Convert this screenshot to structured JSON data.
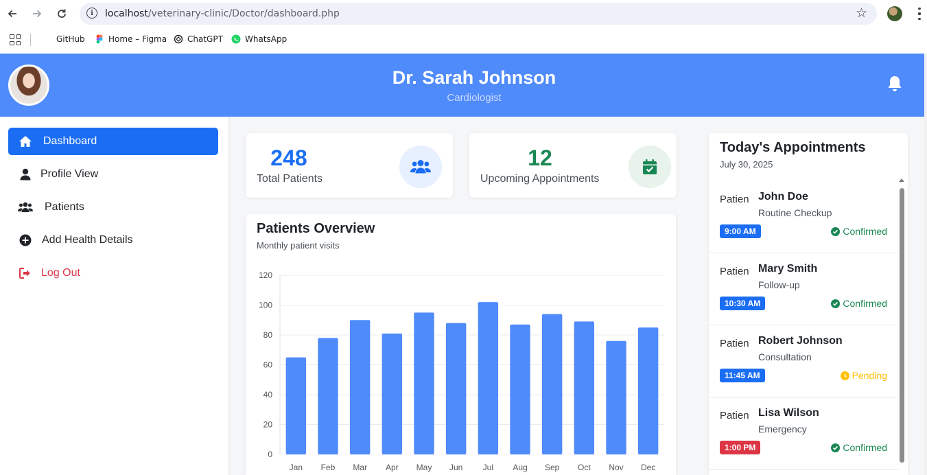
{
  "browser": {
    "url_host": "localhost",
    "url_path": "/veterinary-clinic/Doctor/dashboard.php",
    "bookmarks": [
      {
        "label": "GitHub",
        "icon": "github-icon"
      },
      {
        "label": "Home – Figma",
        "icon": "figma-icon"
      },
      {
        "label": "ChatGPT",
        "icon": "chatgpt-icon"
      },
      {
        "label": "WhatsApp",
        "icon": "whatsapp-icon"
      }
    ]
  },
  "header": {
    "doctor_name": "Dr. Sarah Johnson",
    "specialty": "Cardiologist",
    "bg_color": "#508bfc"
  },
  "sidebar": {
    "items": [
      {
        "label": "Dashboard",
        "icon": "home-icon",
        "active": true
      },
      {
        "label": "Profile View",
        "icon": "user-icon",
        "active": false
      },
      {
        "label": "Patients",
        "icon": "users-icon",
        "active": false
      },
      {
        "label": "Add Health Details",
        "icon": "plus-circle-icon",
        "active": false
      },
      {
        "label": "Log Out",
        "icon": "logout-icon",
        "active": false
      }
    ]
  },
  "stats": [
    {
      "value": "248",
      "label": "Total Patients",
      "color": "#1b6ef3",
      "icon": "users-icon"
    },
    {
      "value": "12",
      "label": "Upcoming Appointments",
      "color": "#198754",
      "icon": "calendar-check-icon"
    }
  ],
  "chart": {
    "title": "Patients Overview",
    "subtitle": "Monthly patient visits"
  },
  "chart_data": {
    "type": "bar",
    "categories": [
      "Jan",
      "Feb",
      "Mar",
      "Apr",
      "May",
      "Jun",
      "Jul",
      "Aug",
      "Sep",
      "Oct",
      "Nov",
      "Dec"
    ],
    "values": [
      65,
      78,
      90,
      81,
      95,
      88,
      102,
      87,
      94,
      89,
      76,
      85
    ],
    "ylim": [
      0,
      120
    ],
    "yticks": [
      0,
      20,
      40,
      60,
      80,
      100,
      120
    ],
    "bar_color": "#508bfc",
    "grid": true,
    "legend": "none"
  },
  "appointments": {
    "title": "Today's Appointments",
    "date": "July 30, 2025",
    "img_alt": "Patient",
    "items": [
      {
        "name": "John Doe",
        "type": "Routine Checkup",
        "time": "9:00 AM",
        "time_color": "#1b6ef3",
        "status": "Confirmed",
        "status_color": "#198754",
        "status_icon": "check-circle-icon"
      },
      {
        "name": "Mary Smith",
        "type": "Follow-up",
        "time": "10:30 AM",
        "time_color": "#1b6ef3",
        "status": "Confirmed",
        "status_color": "#198754",
        "status_icon": "check-circle-icon"
      },
      {
        "name": "Robert Johnson",
        "type": "Consultation",
        "time": "11:45 AM",
        "time_color": "#1b6ef3",
        "status": "Pending",
        "status_color": "#ffc107",
        "status_icon": "clock-icon"
      },
      {
        "name": "Lisa Wilson",
        "type": "Emergency",
        "time": "1:00 PM",
        "time_color": "#dc3545",
        "status": "Confirmed",
        "status_color": "#198754",
        "status_icon": "check-circle-icon"
      }
    ]
  }
}
